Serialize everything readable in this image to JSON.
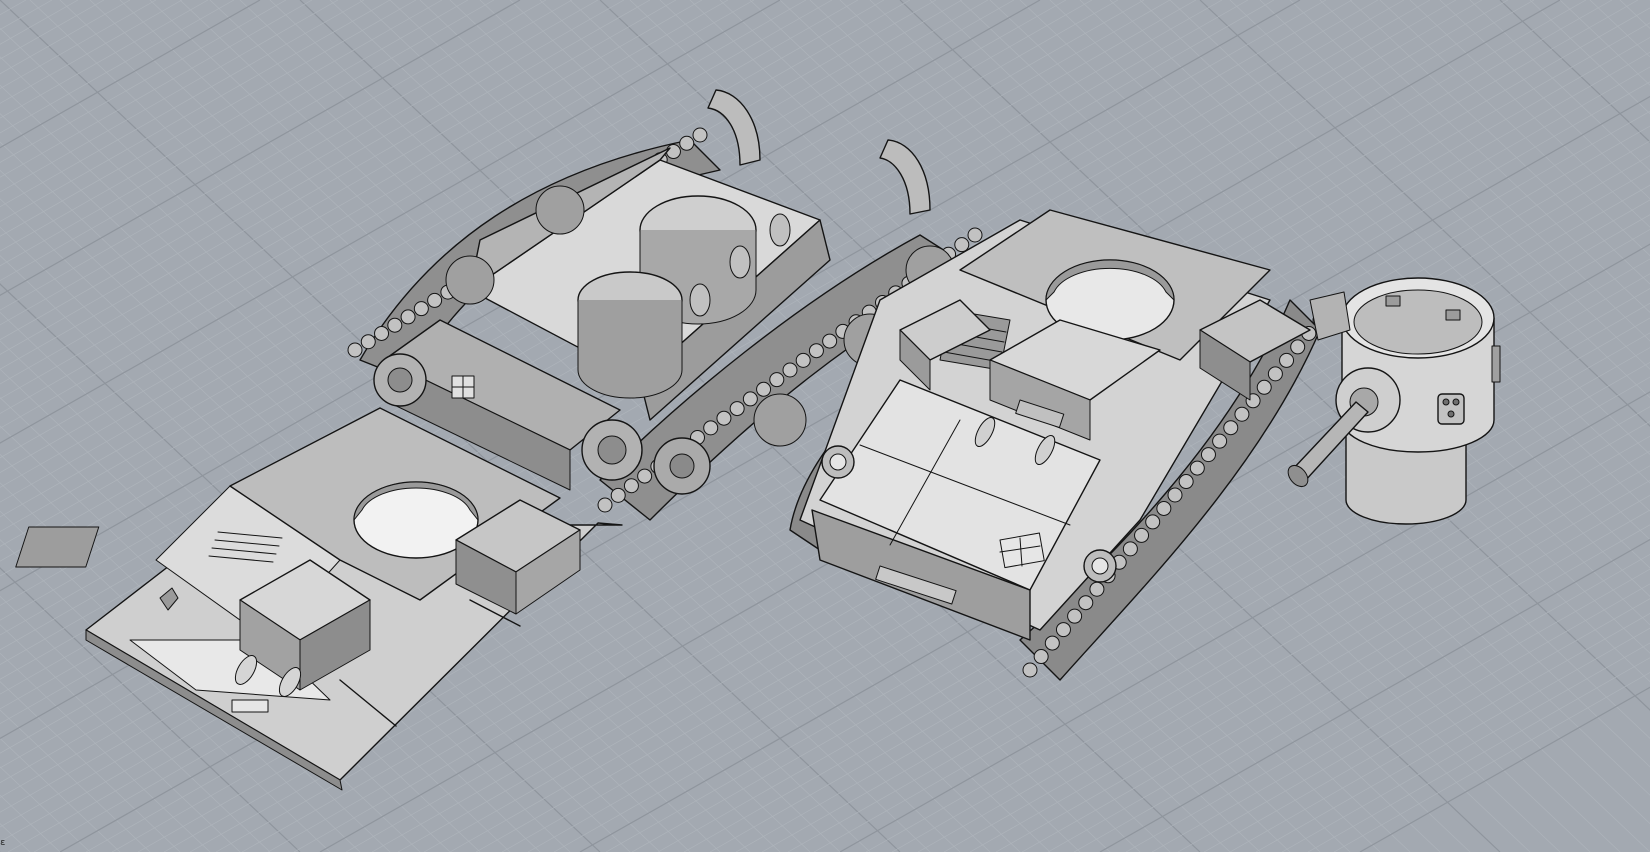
{
  "viewport": {
    "background_color": "#a3a9b1",
    "grid_minor_color": "#aeb4bb",
    "grid_major_color": "#8f959d",
    "edge_color": "#141414",
    "surface_light": "#e9e9e9",
    "surface_mid": "#c7c7c7",
    "surface_dark": "#8d8d8d",
    "corner_glyph": "ε"
  },
  "scene": {
    "objects": [
      {
        "name": "lower-hull-plate",
        "icon": "tank-hull-icon"
      },
      {
        "name": "open-chassis-with-tracks",
        "icon": "tank-chassis-icon"
      },
      {
        "name": "assembled-tank-hull",
        "icon": "tank-icon"
      },
      {
        "name": "detached-turret",
        "icon": "turret-icon"
      }
    ]
  }
}
